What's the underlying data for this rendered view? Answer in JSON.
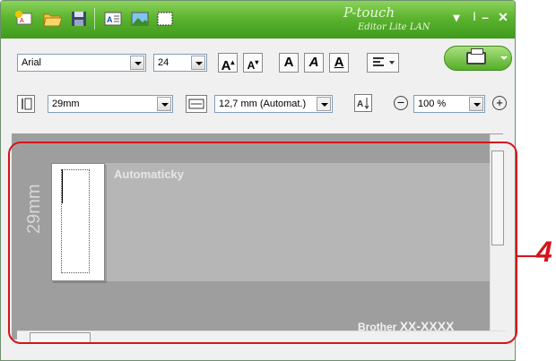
{
  "title": {
    "brand": "P-touch",
    "subtitle": "Editor Lite LAN"
  },
  "toolbar": {
    "font_name": "Arial",
    "font_size": "24",
    "tape_width": "29mm",
    "length": "12,7 mm (Automat.)",
    "zoom": "100 %"
  },
  "canvas": {
    "tape_width_label": "29mm",
    "length_mode_label": "Automaticky",
    "printer_brand": "Brother",
    "printer_model": "XX-XXXX"
  },
  "callout": {
    "number": "4",
    "color": "#d4141d"
  },
  "colors": {
    "title_green": "#5cb42f",
    "canvas_gray": "#9e9e9e"
  }
}
